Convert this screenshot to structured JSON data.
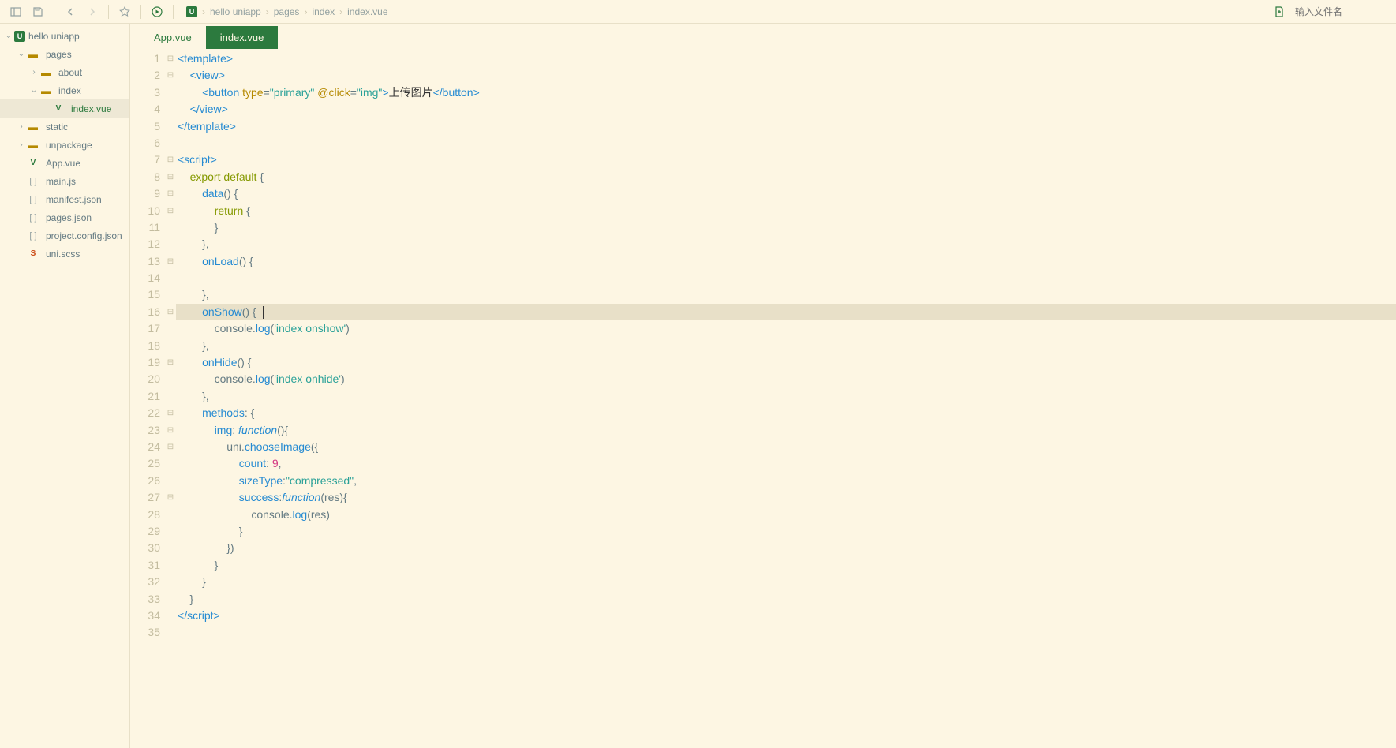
{
  "toolbar": {
    "search_placeholder": "输入文件名"
  },
  "breadcrumb": {
    "project_icon": "U",
    "items": [
      "hello uniapp",
      "pages",
      "index",
      "index.vue"
    ]
  },
  "sidebar": {
    "project_icon": "U",
    "items": [
      {
        "label": "hello uniapp",
        "depth": 0,
        "type": "project",
        "expanded": true
      },
      {
        "label": "pages",
        "depth": 1,
        "type": "folder",
        "expanded": true
      },
      {
        "label": "about",
        "depth": 2,
        "type": "folder",
        "expanded": false
      },
      {
        "label": "index",
        "depth": 2,
        "type": "folder",
        "expanded": true
      },
      {
        "label": "index.vue",
        "depth": 3,
        "type": "file-vue",
        "active": true
      },
      {
        "label": "static",
        "depth": 1,
        "type": "folder",
        "expanded": false
      },
      {
        "label": "unpackage",
        "depth": 1,
        "type": "folder",
        "expanded": false
      },
      {
        "label": "App.vue",
        "depth": 1,
        "type": "file-vue"
      },
      {
        "label": "main.js",
        "depth": 1,
        "type": "file-js"
      },
      {
        "label": "manifest.json",
        "depth": 1,
        "type": "file-json"
      },
      {
        "label": "pages.json",
        "depth": 1,
        "type": "file-json"
      },
      {
        "label": "project.config.json",
        "depth": 1,
        "type": "file-json"
      },
      {
        "label": "uni.scss",
        "depth": 1,
        "type": "file-scss"
      }
    ]
  },
  "tabs": [
    {
      "label": "App.vue",
      "active": false
    },
    {
      "label": "index.vue",
      "active": true
    }
  ],
  "code": {
    "highlighted_line": 16,
    "lines": [
      {
        "n": 1,
        "fold": "⊟",
        "tokens": [
          [
            "tag",
            "<template>"
          ]
        ]
      },
      {
        "n": 2,
        "fold": "⊟",
        "tokens": [
          [
            "id",
            "    "
          ],
          [
            "tag",
            "<view>"
          ]
        ]
      },
      {
        "n": 3,
        "fold": "",
        "tokens": [
          [
            "id",
            "        "
          ],
          [
            "tag",
            "<button "
          ],
          [
            "attr",
            "type"
          ],
          [
            "op",
            "="
          ],
          [
            "str",
            "\"primary\""
          ],
          [
            "tag",
            " "
          ],
          [
            "attr",
            "@click"
          ],
          [
            "op",
            "="
          ],
          [
            "str",
            "\"img\""
          ],
          [
            "tag",
            ">"
          ],
          [
            "text",
            "上传图片"
          ],
          [
            "tag",
            "</button>"
          ]
        ]
      },
      {
        "n": 4,
        "fold": "",
        "tokens": [
          [
            "id",
            "    "
          ],
          [
            "tag",
            "</view>"
          ]
        ]
      },
      {
        "n": 5,
        "fold": "",
        "tokens": [
          [
            "tag",
            "</template>"
          ]
        ]
      },
      {
        "n": 6,
        "fold": "",
        "tokens": [
          [
            "id",
            ""
          ]
        ]
      },
      {
        "n": 7,
        "fold": "⊟",
        "tokens": [
          [
            "tag",
            "<script>"
          ]
        ]
      },
      {
        "n": 8,
        "fold": "⊟",
        "tokens": [
          [
            "id",
            "    "
          ],
          [
            "kw",
            "export default"
          ],
          [
            "id",
            " {"
          ]
        ]
      },
      {
        "n": 9,
        "fold": "⊟",
        "tokens": [
          [
            "id",
            "        "
          ],
          [
            "fn",
            "data"
          ],
          [
            "id",
            "() {"
          ]
        ]
      },
      {
        "n": 10,
        "fold": "⊟",
        "tokens": [
          [
            "id",
            "            "
          ],
          [
            "kw",
            "return"
          ],
          [
            "id",
            " {"
          ]
        ]
      },
      {
        "n": 11,
        "fold": "",
        "tokens": [
          [
            "id",
            "            }"
          ]
        ]
      },
      {
        "n": 12,
        "fold": "",
        "tokens": [
          [
            "id",
            "        },"
          ]
        ]
      },
      {
        "n": 13,
        "fold": "⊟",
        "tokens": [
          [
            "id",
            "        "
          ],
          [
            "fn",
            "onLoad"
          ],
          [
            "id",
            "() {"
          ]
        ]
      },
      {
        "n": 14,
        "fold": "",
        "tokens": [
          [
            "id",
            ""
          ]
        ]
      },
      {
        "n": 15,
        "fold": "",
        "tokens": [
          [
            "id",
            "        },"
          ]
        ]
      },
      {
        "n": 16,
        "fold": "⊟",
        "tokens": [
          [
            "id",
            "        "
          ],
          [
            "fn",
            "onShow"
          ],
          [
            "id",
            "() {"
          ]
        ],
        "cursor": true
      },
      {
        "n": 17,
        "fold": "",
        "tokens": [
          [
            "id",
            "            console."
          ],
          [
            "fn",
            "log"
          ],
          [
            "id",
            "("
          ],
          [
            "str",
            "'index onshow'"
          ],
          [
            "id",
            ")"
          ]
        ]
      },
      {
        "n": 18,
        "fold": "",
        "tokens": [
          [
            "id",
            "        },"
          ]
        ]
      },
      {
        "n": 19,
        "fold": "⊟",
        "tokens": [
          [
            "id",
            "        "
          ],
          [
            "fn",
            "onHide"
          ],
          [
            "id",
            "() {"
          ]
        ]
      },
      {
        "n": 20,
        "fold": "",
        "tokens": [
          [
            "id",
            "            console."
          ],
          [
            "fn",
            "log"
          ],
          [
            "id",
            "("
          ],
          [
            "str",
            "'index onhide'"
          ],
          [
            "id",
            ")"
          ]
        ]
      },
      {
        "n": 21,
        "fold": "",
        "tokens": [
          [
            "id",
            "        },"
          ]
        ]
      },
      {
        "n": 22,
        "fold": "⊟",
        "tokens": [
          [
            "id",
            "        "
          ],
          [
            "fn",
            "methods"
          ],
          [
            "id",
            ": {"
          ]
        ]
      },
      {
        "n": 23,
        "fold": "⊟",
        "tokens": [
          [
            "id",
            "            "
          ],
          [
            "fn",
            "img"
          ],
          [
            "id",
            ": "
          ],
          [
            "fn-italic",
            "function"
          ],
          [
            "id",
            "(){"
          ]
        ]
      },
      {
        "n": 24,
        "fold": "⊟",
        "tokens": [
          [
            "id",
            "                uni."
          ],
          [
            "fn",
            "chooseImage"
          ],
          [
            "id",
            "({"
          ]
        ]
      },
      {
        "n": 25,
        "fold": "",
        "tokens": [
          [
            "id",
            "                    "
          ],
          [
            "fn",
            "count"
          ],
          [
            "id",
            ": "
          ],
          [
            "num",
            "9"
          ],
          [
            "id",
            ","
          ]
        ]
      },
      {
        "n": 26,
        "fold": "",
        "tokens": [
          [
            "id",
            "                    "
          ],
          [
            "fn",
            "sizeType"
          ],
          [
            "id",
            ":"
          ],
          [
            "str",
            "\"compressed\""
          ],
          [
            "id",
            ","
          ]
        ]
      },
      {
        "n": 27,
        "fold": "⊟",
        "tokens": [
          [
            "id",
            "                    "
          ],
          [
            "fn",
            "success"
          ],
          [
            "id",
            ":"
          ],
          [
            "fn-italic",
            "function"
          ],
          [
            "id",
            "(res){"
          ]
        ]
      },
      {
        "n": 28,
        "fold": "",
        "tokens": [
          [
            "id",
            "                        console."
          ],
          [
            "fn",
            "log"
          ],
          [
            "id",
            "(res)"
          ]
        ]
      },
      {
        "n": 29,
        "fold": "",
        "tokens": [
          [
            "id",
            "                    }"
          ]
        ]
      },
      {
        "n": 30,
        "fold": "",
        "tokens": [
          [
            "id",
            "                })"
          ]
        ]
      },
      {
        "n": 31,
        "fold": "",
        "tokens": [
          [
            "id",
            "            }"
          ]
        ]
      },
      {
        "n": 32,
        "fold": "",
        "tokens": [
          [
            "id",
            "        }"
          ]
        ]
      },
      {
        "n": 33,
        "fold": "",
        "tokens": [
          [
            "id",
            "    }"
          ]
        ]
      },
      {
        "n": 34,
        "fold": "",
        "tokens": [
          [
            "tag",
            "<"
          ],
          [
            "tag",
            "/script>"
          ]
        ]
      },
      {
        "n": 35,
        "fold": "",
        "tokens": [
          [
            "id",
            ""
          ]
        ]
      }
    ]
  }
}
